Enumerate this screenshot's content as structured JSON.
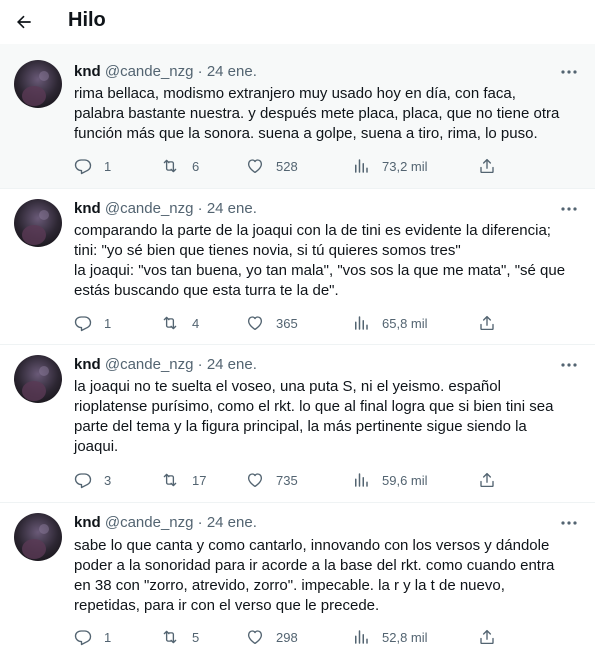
{
  "header": {
    "title": "Hilo"
  },
  "tweets": [
    {
      "name": "knd",
      "handle": "@cande_nzg",
      "dot": "·",
      "date": "24 ene.",
      "lines": [
        "rima bellaca, modismo extranjero muy usado hoy en día, con faca,",
        "palabra bastante nuestra. y después mete placa, placa, que no tiene otra",
        "función más que la sonora. suena a golpe, suena a tiro, rima, lo puso."
      ],
      "replies": "1",
      "retweets": "6",
      "likes": "528",
      "views": "73,2 mil"
    },
    {
      "name": "knd",
      "handle": "@cande_nzg",
      "dot": "·",
      "date": "24 ene.",
      "lines": [
        "comparando la parte de la joaqui con la de tini es evidente la diferencia;",
        "tini: \"yo sé bien que tienes novia, si tú quieres somos tres\"",
        "la joaqui: \"vos tan buena, yo tan mala\", \"vos sos la que me mata\", \"sé que",
        "estás buscando que esta turra te la de\"."
      ],
      "replies": "1",
      "retweets": "4",
      "likes": "365",
      "views": "65,8 mil"
    },
    {
      "name": "knd",
      "handle": "@cande_nzg",
      "dot": "·",
      "date": "24 ene.",
      "lines": [
        "la joaqui no te suelta el voseo, una puta S, ni el yeismo. español",
        "rioplatense purísimo, como el rkt. lo que al final logra que si bien tini sea",
        "parte del tema y la figura principal, la más pertinente sigue siendo la",
        "joaqui."
      ],
      "replies": "3",
      "retweets": "17",
      "likes": "735",
      "views": "59,6 mil"
    },
    {
      "name": "knd",
      "handle": "@cande_nzg",
      "dot": "·",
      "date": "24 ene.",
      "lines": [
        "sabe lo que canta y como cantarlo, innovando con los versos y dándole",
        "poder a la sonoridad para ir acorde a la base del rkt. como cuando entra",
        "en 38 con \"zorro, atrevido, zorro\". impecable. la r y la t de nuevo,",
        "repetidas, para ir con el verso que le precede."
      ],
      "replies": "1",
      "retweets": "5",
      "likes": "298",
      "views": "52,8 mil"
    }
  ],
  "icons": {
    "back": "arrow-left-icon",
    "more": "more-horizontal-icon",
    "reply": "reply-icon",
    "retweet": "retweet-icon",
    "like": "heart-icon",
    "views": "views-chart-icon",
    "share": "share-icon"
  },
  "colors": {
    "text": "#0f1419",
    "secondary": "#536471",
    "thread_background": "#f7f9f9"
  }
}
